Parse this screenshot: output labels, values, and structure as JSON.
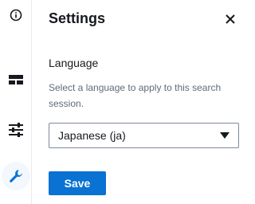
{
  "rail": {
    "items": [
      {
        "icon": "info-icon"
      },
      {
        "icon": "layout-icon"
      },
      {
        "icon": "sliders-icon"
      },
      {
        "icon": "wrench-icon",
        "active": true
      }
    ],
    "active_color": "#0972d3"
  },
  "panel": {
    "title": "Settings",
    "close_icon": "close-icon",
    "language_label": "Language",
    "description": "Select a language to apply to this search session.",
    "select": {
      "value": "Japanese (ja)",
      "icon": "caret-down-icon"
    },
    "save_label": "Save"
  },
  "colors": {
    "primary": "#0972d3",
    "text": "#16191f",
    "muted": "#5f6b7a",
    "border": "#7d8998"
  }
}
